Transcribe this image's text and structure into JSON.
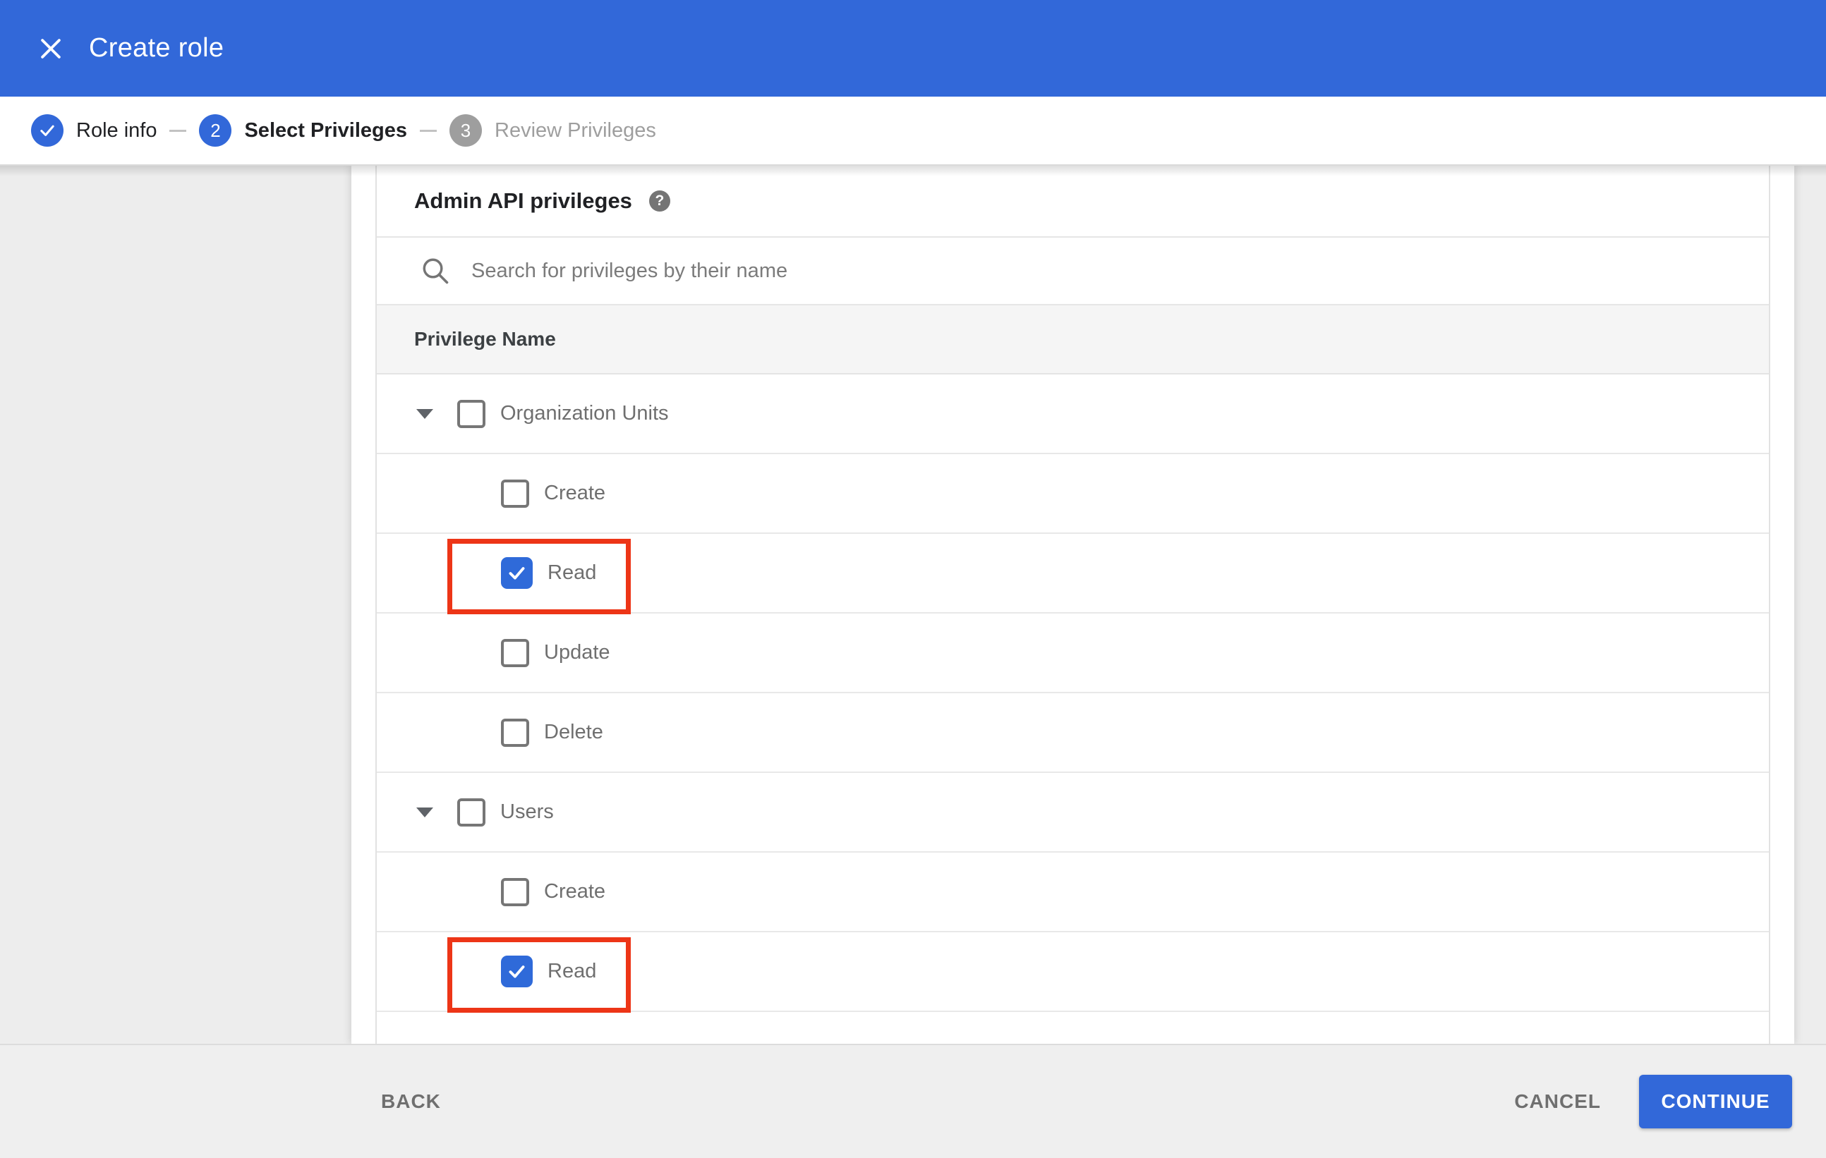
{
  "header": {
    "title": "Create role"
  },
  "stepper": {
    "steps": [
      {
        "number": "1",
        "label": "Role info",
        "state": "complete"
      },
      {
        "number": "2",
        "label": "Select Privileges",
        "state": "current"
      },
      {
        "number": "3",
        "label": "Review Privileges",
        "state": "upcoming"
      }
    ]
  },
  "privileges": {
    "section_title": "Admin API privileges",
    "help_icon_glyph": "?",
    "search_placeholder": "Search for privileges by their name",
    "column_header": "Privilege Name",
    "groups": [
      {
        "label": "Organization Units",
        "checked": false,
        "expanded": true,
        "children": [
          {
            "label": "Create",
            "checked": false
          },
          {
            "label": "Read",
            "checked": true,
            "highlighted": true
          },
          {
            "label": "Update",
            "checked": false
          },
          {
            "label": "Delete",
            "checked": false
          }
        ]
      },
      {
        "label": "Users",
        "checked": false,
        "expanded": true,
        "children": [
          {
            "label": "Create",
            "checked": false
          },
          {
            "label": "Read",
            "checked": true,
            "highlighted": true
          }
        ]
      }
    ]
  },
  "footer": {
    "back_label": "BACK",
    "cancel_label": "CANCEL",
    "continue_label": "CONTINUE"
  },
  "colors": {
    "accent_blue": "#3268d9",
    "inactive_step_gray": "#9e9e9e",
    "highlight_red": "#ed3517",
    "table_header_bg": "#f5f5f5",
    "footer_bg": "#efefef"
  }
}
